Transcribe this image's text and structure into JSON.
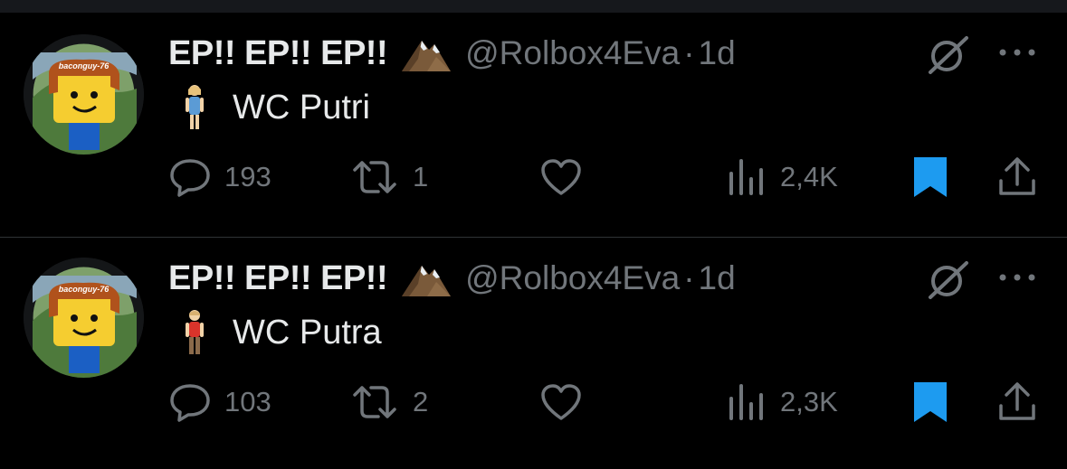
{
  "tweets": [
    {
      "display_name": "EP!! EP!! EP!!",
      "badge_icon": "mountain-emoji",
      "handle": "@Rolbox4Eva",
      "separator": "·",
      "time": "1d",
      "avatar_tag": "baconguy-76",
      "body_icon": "woman-standing-emoji",
      "text": "WC Putri",
      "replies": "193",
      "retweets": "1",
      "likes": "",
      "views": "2,4K",
      "bookmarked": true
    },
    {
      "display_name": "EP!! EP!! EP!!",
      "badge_icon": "mountain-emoji",
      "handle": "@Rolbox4Eva",
      "separator": "·",
      "time": "1d",
      "avatar_tag": "baconguy-76",
      "body_icon": "man-standing-emoji",
      "text": "WC Putra",
      "replies": "103",
      "retweets": "2",
      "likes": "",
      "views": "2,3K",
      "bookmarked": true
    }
  ],
  "colors": {
    "background": "#000000",
    "text": "#e7e9ea",
    "muted": "#71767b",
    "bookmark_active": "#1d9bf0",
    "divider": "#2f3336"
  }
}
